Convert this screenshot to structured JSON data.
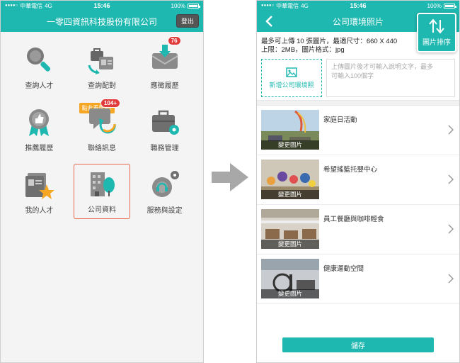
{
  "status": {
    "carrier": "中華電信",
    "network": "4G",
    "time": "15:46",
    "battery": "100%"
  },
  "left": {
    "title": "一零四資訊科技股份有限公司",
    "logout": "登出",
    "tiles": [
      {
        "label": "查詢人才"
      },
      {
        "label": "查詢配對"
      },
      {
        "label": "應徵履歷",
        "badge": "76"
      },
      {
        "label": "推薦履歷"
      },
      {
        "label": "聯絡訊息",
        "badge": "104+",
        "tip": "點此看配對!"
      },
      {
        "label": "職務管理"
      },
      {
        "label": "我的人才"
      },
      {
        "label": "公司資料"
      },
      {
        "label": "服務與設定"
      }
    ]
  },
  "right": {
    "title": "公司環境照片",
    "sort_label": "圖片排序",
    "info_line1": "最多可上傳 10 張圖片，最適尺寸：660 X 440",
    "info_line2": "上限：2MB，圖片格式：jpg",
    "add_label": "新增公司環境照",
    "desc_placeholder_1": "上傳圖片後才可輸入說明文字，最多",
    "desc_placeholder_2": "可輸入100個字",
    "change_label": "變更圖片",
    "photos": [
      {
        "title": "家庭日活動"
      },
      {
        "title": "希望搖籃托嬰中心"
      },
      {
        "title": "員工餐廳與咖啡輕食"
      },
      {
        "title": "健康運動空間"
      }
    ],
    "save": "儲存"
  },
  "colors": {
    "accent": "#1fb8b0",
    "badge": "#e23b3b",
    "tip": "#f5a623",
    "selected": "#e8664a"
  }
}
